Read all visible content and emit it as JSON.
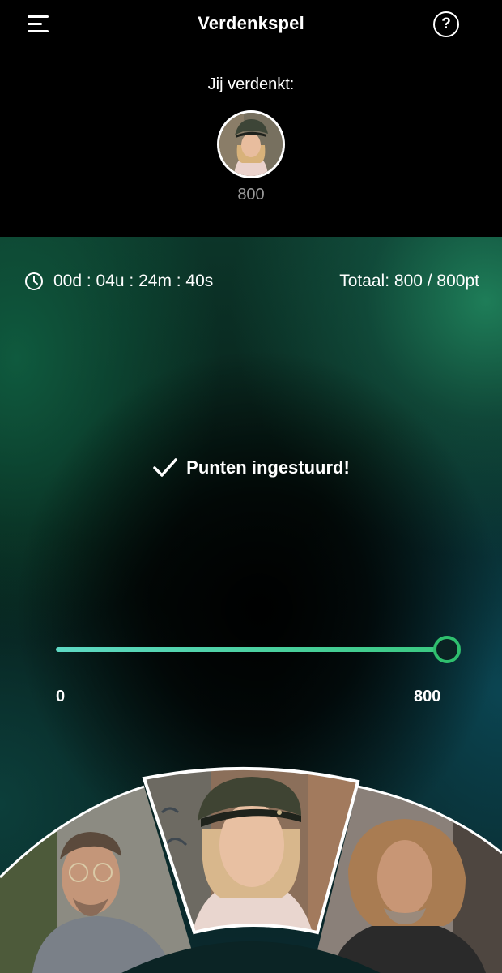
{
  "header": {
    "title": "Verdenkspel",
    "help_label": "?",
    "suspect_label": "Jij verdenkt:",
    "suspect_points": "800"
  },
  "status_bar": {
    "timer": "00d : 04u : 24m : 40s",
    "total": "Totaal: 800 / 800pt"
  },
  "confirmation": {
    "text": "Punten ingestuurd!"
  },
  "slider": {
    "min_label": "0",
    "max_label": "800",
    "value": 800,
    "max": 800
  },
  "candidates": [
    {
      "name": "candidate-left",
      "selected": false
    },
    {
      "name": "candidate-center",
      "selected": true
    },
    {
      "name": "candidate-right",
      "selected": false
    }
  ],
  "colors": {
    "accent": "#2fbf6e",
    "track_start": "#5fd9c4",
    "track_end": "#3ac880"
  }
}
